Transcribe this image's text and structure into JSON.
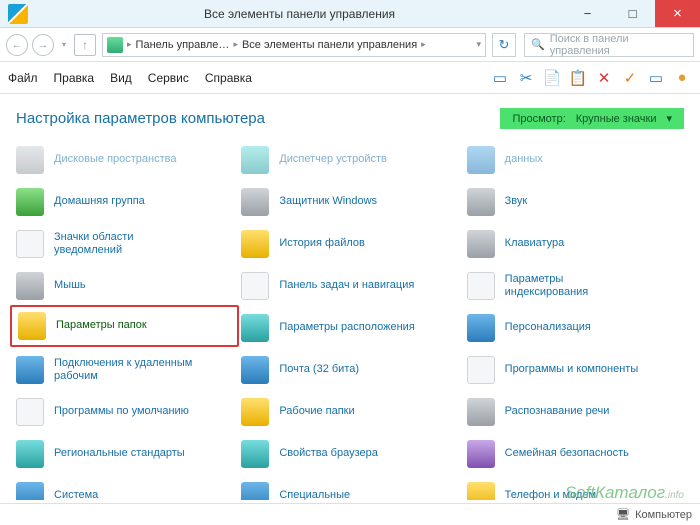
{
  "window": {
    "title": "Все элементы панели управления",
    "min_tip": "−",
    "max_tip": "□",
    "close_tip": "×"
  },
  "nav": {
    "back": "←",
    "fwd": "→",
    "up": "↑",
    "path_icon": "■",
    "seg1": "Панель управле…",
    "seg2": "Все элементы панели управления",
    "dropdown": "▾",
    "refresh": "↻",
    "search_placeholder": "Поиск в панели управления",
    "search_icon": "🔍"
  },
  "menu": {
    "items": [
      "Файл",
      "Правка",
      "Вид",
      "Сервис",
      "Справка"
    ]
  },
  "toolbar_icons": [
    {
      "name": "panel-icon",
      "glyph": "▭",
      "color": "#2a7dbb"
    },
    {
      "name": "cut-icon",
      "glyph": "✂",
      "color": "#2a7dbb"
    },
    {
      "name": "copy-icon",
      "glyph": "📄",
      "color": "#2a7dbb"
    },
    {
      "name": "paste-icon",
      "glyph": "📋",
      "color": "#7a5a3a"
    },
    {
      "name": "delete-icon",
      "glyph": "✕",
      "color": "#d93838"
    },
    {
      "name": "apply-icon",
      "glyph": "✓",
      "color": "#e07a20"
    },
    {
      "name": "props-icon",
      "glyph": "▭",
      "color": "#2a7dbb"
    },
    {
      "name": "globe-icon",
      "glyph": "●",
      "color": "#e0a030"
    }
  ],
  "header": {
    "title": "Настройка параметров компьютера",
    "view_label": "Просмотр:",
    "view_value": "Крупные значки",
    "view_caret": "▾"
  },
  "items": [
    {
      "label": "Дисковые пространства",
      "icon": "bg-gray",
      "cut": true
    },
    {
      "label": "Диспетчер устройств",
      "icon": "bg-teal",
      "cut": true
    },
    {
      "label": "данных",
      "icon": "bg-blue",
      "cut": true
    },
    {
      "label": "Домашняя группа",
      "icon": "bg-green"
    },
    {
      "label": "Защитник Windows",
      "icon": "bg-gray"
    },
    {
      "label": "Звук",
      "icon": "bg-gray"
    },
    {
      "label": "Значки области уведомлений",
      "icon": "bg-white"
    },
    {
      "label": "История файлов",
      "icon": "bg-yellow"
    },
    {
      "label": "Клавиатура",
      "icon": "bg-gray"
    },
    {
      "label": "Мышь",
      "icon": "bg-gray"
    },
    {
      "label": "Панель задач и навигация",
      "icon": "bg-white"
    },
    {
      "label": "Параметры индексирования",
      "icon": "bg-white"
    },
    {
      "label": "Параметры папок",
      "icon": "bg-yellow",
      "hl": true
    },
    {
      "label": "Параметры расположения",
      "icon": "bg-teal"
    },
    {
      "label": "Персонализация",
      "icon": "bg-blue"
    },
    {
      "label": "Подключения к удаленным рабочим",
      "icon": "bg-blue"
    },
    {
      "label": "Почта (32 бита)",
      "icon": "bg-blue"
    },
    {
      "label": "Программы и компоненты",
      "icon": "bg-white"
    },
    {
      "label": "Программы по умолчанию",
      "icon": "bg-white"
    },
    {
      "label": "Рабочие папки",
      "icon": "bg-yellow"
    },
    {
      "label": "Распознавание речи",
      "icon": "bg-gray"
    },
    {
      "label": "Региональные стандарты",
      "icon": "bg-teal"
    },
    {
      "label": "Свойства браузера",
      "icon": "bg-teal"
    },
    {
      "label": "Семейная безопасность",
      "icon": "bg-purple"
    },
    {
      "label": "Система",
      "icon": "bg-blue"
    },
    {
      "label": "Специальные",
      "icon": "bg-blue"
    },
    {
      "label": "Телефон и модем",
      "icon": "bg-yellow"
    }
  ],
  "status": {
    "text": "Компьютер",
    "icon": "🖥"
  },
  "watermark": {
    "main": "SoftКаталог",
    "suffix": ".info"
  }
}
